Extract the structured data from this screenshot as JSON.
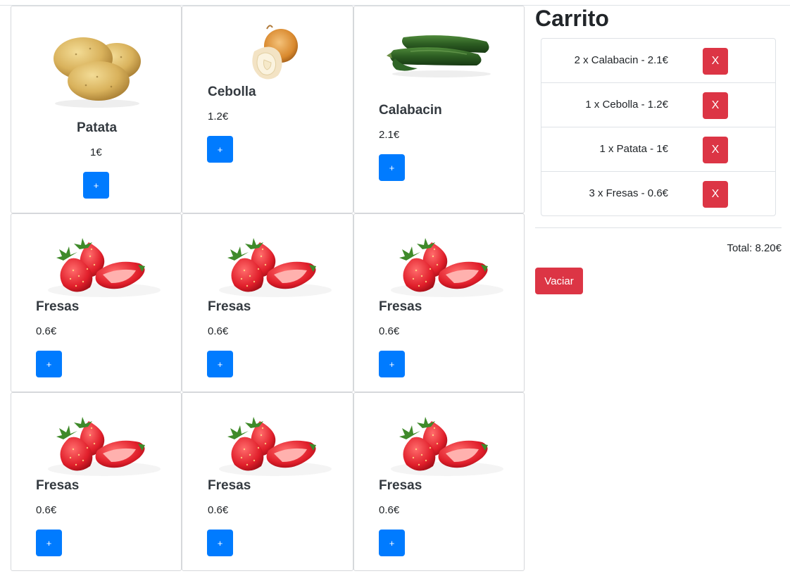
{
  "products": [
    {
      "name": "Patata",
      "price": "1€",
      "add_label": "+",
      "icon": "potato-image"
    },
    {
      "name": "Cebolla",
      "price": "1.2€",
      "add_label": "+",
      "icon": "onion-image"
    },
    {
      "name": "Calabacin",
      "price": "2.1€",
      "add_label": "+",
      "icon": "zucchini-image"
    },
    {
      "name": "Fresas",
      "price": "0.6€",
      "add_label": "+",
      "icon": "strawberries-image"
    },
    {
      "name": "Fresas",
      "price": "0.6€",
      "add_label": "+",
      "icon": "strawberries-image"
    },
    {
      "name": "Fresas",
      "price": "0.6€",
      "add_label": "+",
      "icon": "strawberries-image"
    },
    {
      "name": "Fresas",
      "price": "0.6€",
      "add_label": "+",
      "icon": "strawberries-image"
    },
    {
      "name": "Fresas",
      "price": "0.6€",
      "add_label": "+",
      "icon": "strawberries-image"
    },
    {
      "name": "Fresas",
      "price": "0.6€",
      "add_label": "+",
      "icon": "strawberries-image"
    }
  ],
  "cart": {
    "title": "Carrito",
    "items": [
      {
        "text": "2 x Calabacin - 2.1€",
        "remove_label": "X"
      },
      {
        "text": "1 x Cebolla - 1.2€",
        "remove_label": "X"
      },
      {
        "text": "1 x Patata - 1€",
        "remove_label": "X"
      },
      {
        "text": "3 x Fresas - 0.6€",
        "remove_label": "X"
      }
    ],
    "total": "Total: 8.20€",
    "empty_label": "Vaciar"
  },
  "colors": {
    "primary": "#007bff",
    "danger": "#dc3545",
    "border": "#dee2e6"
  }
}
